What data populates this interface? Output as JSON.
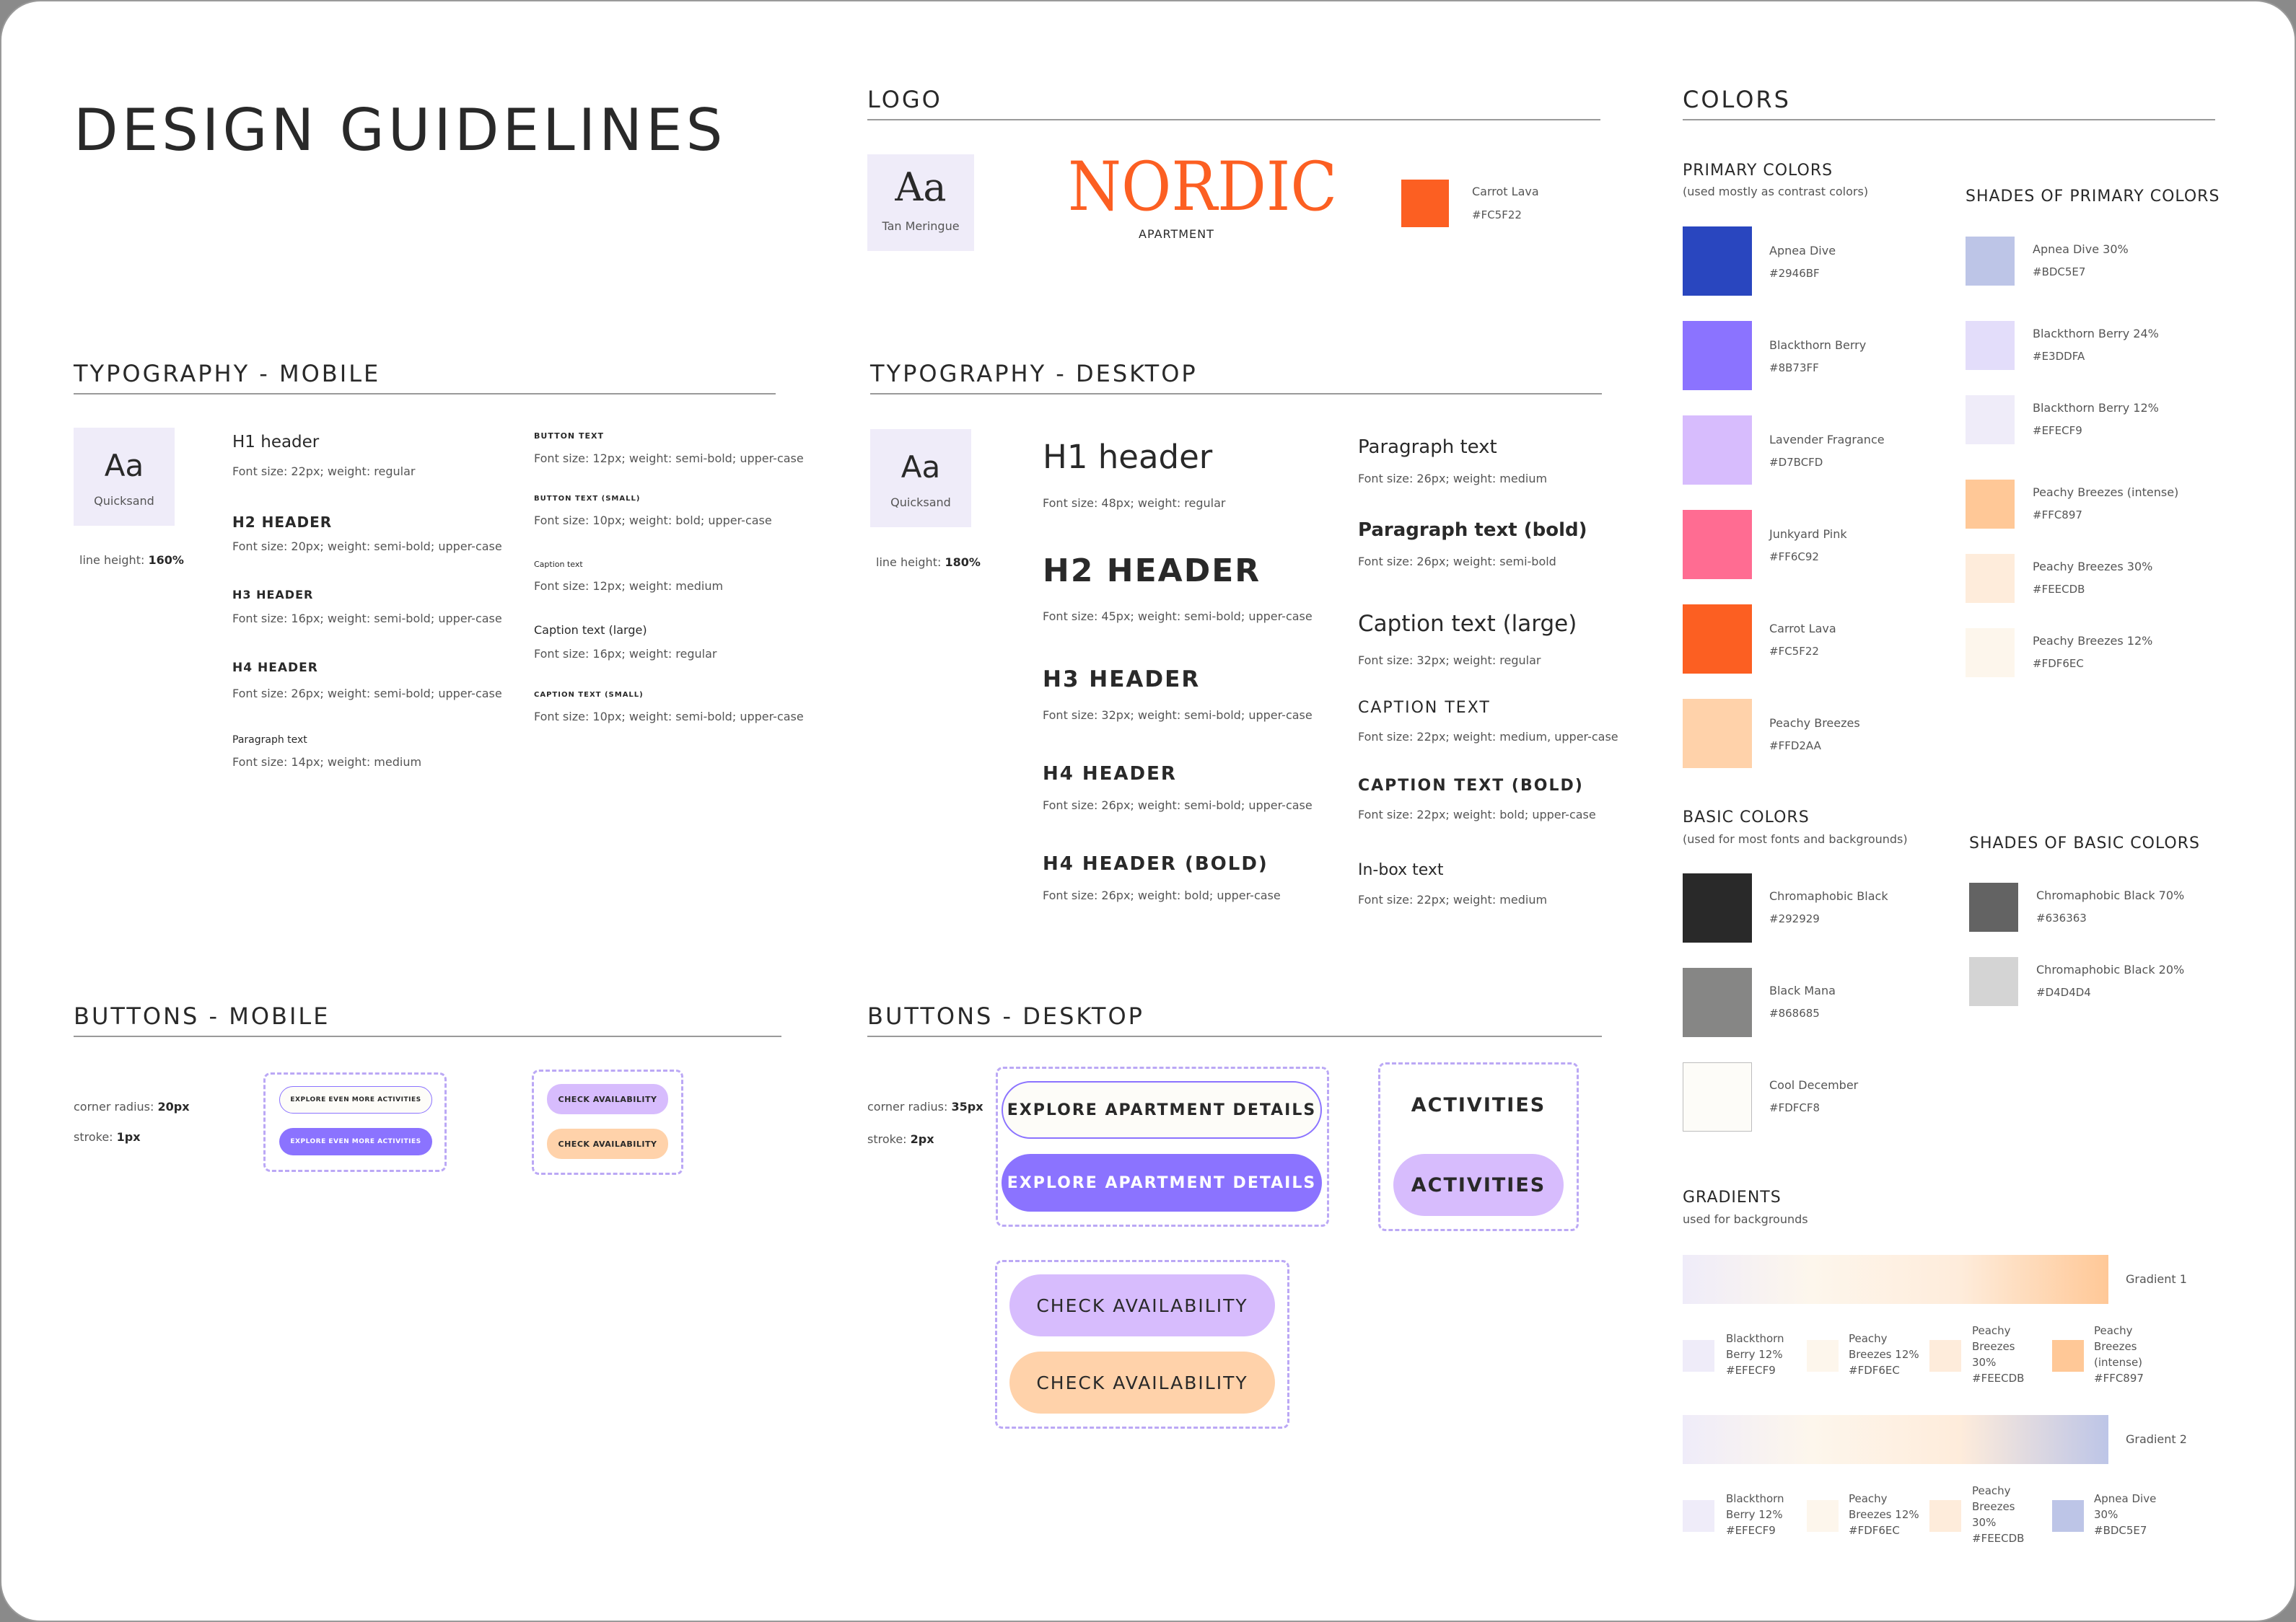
{
  "title": "DESIGN GUIDELINES",
  "logo": {
    "heading": "LOGO",
    "font_sample": "Aa",
    "font_name": "Tan Meringue",
    "brand": "NORDIC",
    "brand_sub": "APARTMENT",
    "brand_color": {
      "name": "Carrot Lava",
      "hex": "#FC5F22"
    }
  },
  "colors": {
    "heading": "COLORS",
    "primary_heading": "PRIMARY COLORS",
    "primary_note": "(used mostly as contrast colors)",
    "primary": [
      {
        "name": "Apnea Dive",
        "hex": "#2946BF"
      },
      {
        "name": "Blackthorn Berry",
        "hex": "#8B73FF"
      },
      {
        "name": "Lavender Fragrance",
        "hex": "#D7BCFD"
      },
      {
        "name": "Junkyard Pink",
        "hex": "#FF6C92"
      },
      {
        "name": "Carrot Lava",
        "hex": "#FC5F22"
      },
      {
        "name": "Peachy Breezes",
        "hex": "#FFD2AA"
      }
    ],
    "shades_primary_heading": "SHADES OF PRIMARY COLORS",
    "shades_primary": [
      {
        "name": "Apnea Dive 30%",
        "hex": "#BDC5E7"
      },
      {
        "name": "Blackthorn Berry 24%",
        "hex": "#E3DDFA"
      },
      {
        "name": "Blackthorn Berry 12%",
        "hex": "#EFECF9"
      },
      {
        "name": "Peachy Breezes (intense)",
        "hex": "#FFC897"
      },
      {
        "name": "Peachy Breezes 30%",
        "hex": "#FEECDB"
      },
      {
        "name": "Peachy Breezes 12%",
        "hex": "#FDF6EC"
      }
    ],
    "basic_heading": "BASIC COLORS",
    "basic_note": "(used for most fonts and backgrounds)",
    "basic": [
      {
        "name": "Chromaphobic Black",
        "hex": "#292929"
      },
      {
        "name": "Black Mana",
        "hex": "#868685"
      },
      {
        "name": "Cool December",
        "hex": "#FDFCF8"
      }
    ],
    "shades_basic_heading": "SHADES OF BASIC COLORS",
    "shades_basic": [
      {
        "name": "Chromaphobic Black 70%",
        "hex": "#636363"
      },
      {
        "name": "Chromaphobic Black 20%",
        "hex": "#D4D4D4"
      }
    ],
    "gradients_heading": "GRADIENTS",
    "gradients_note": "used for backgrounds",
    "gradients": [
      {
        "label": "Gradient 1",
        "stops": [
          {
            "name_lines": [
              "Blackthorn",
              "Berry 12%"
            ],
            "hex": "#EFECF9"
          },
          {
            "name_lines": [
              "Peachy",
              "Breezes 12%"
            ],
            "hex": "#FDF6EC"
          },
          {
            "name_lines": [
              "Peachy",
              "Breezes",
              "30%"
            ],
            "hex": "#FEECDB"
          },
          {
            "name_lines": [
              "Peachy",
              "Breezes",
              "(intense)"
            ],
            "hex": "#FFC897"
          }
        ]
      },
      {
        "label": "Gradient 2",
        "stops": [
          {
            "name_lines": [
              "Blackthorn",
              "Berry 12%"
            ],
            "hex": "#EFECF9"
          },
          {
            "name_lines": [
              "Peachy",
              "Breezes 12%"
            ],
            "hex": "#FDF6EC"
          },
          {
            "name_lines": [
              "Peachy",
              "Breezes",
              "30%"
            ],
            "hex": "#FEECDB"
          },
          {
            "name_lines": [
              "Apnea Dive",
              "30%"
            ],
            "hex": "#BDC5E7"
          }
        ]
      }
    ]
  },
  "typo_mobile": {
    "heading": "TYPOGRAPHY - MOBILE",
    "font_sample": "Aa",
    "font_name": "Quicksand",
    "line_height_label": "line height:",
    "line_height_value": "160%",
    "col1": [
      {
        "label": "H1 header",
        "spec": "Font size: 22px; weight: regular"
      },
      {
        "label": "H2 HEADER",
        "spec": "Font size: 20px; weight: semi-bold; upper-case"
      },
      {
        "label": "H3 HEADER",
        "spec": "Font size: 16px; weight: semi-bold; upper-case"
      },
      {
        "label": "H4 HEADER",
        "spec": "Font size: 26px; weight: semi-bold; upper-case"
      },
      {
        "label": "Paragraph text",
        "spec": "Font size: 14px; weight: medium"
      }
    ],
    "col2": [
      {
        "label": "BUTTON TEXT",
        "spec": "Font size: 12px; weight: semi-bold; upper-case"
      },
      {
        "label": "BUTTON TEXT (SMALL)",
        "spec": "Font size: 10px; weight: bold; upper-case"
      },
      {
        "label": "Caption text",
        "spec": "Font size: 12px; weight: medium"
      },
      {
        "label": "Caption text (large)",
        "spec": "Font size: 16px; weight: regular"
      },
      {
        "label": "CAPTION TEXT (SMALL)",
        "spec": "Font size: 10px; weight: semi-bold; upper-case"
      }
    ]
  },
  "typo_desktop": {
    "heading": "TYPOGRAPHY - DESKTOP",
    "font_sample": "Aa",
    "font_name": "Quicksand",
    "line_height_label": "line height:",
    "line_height_value": "180%",
    "col1": [
      {
        "label": "H1 header",
        "spec": "Font size: 48px; weight: regular"
      },
      {
        "label": "H2 HEADER",
        "spec": "Font size: 45px; weight: semi-bold; upper-case"
      },
      {
        "label": "H3 HEADER",
        "spec": "Font size: 32px; weight: semi-bold; upper-case"
      },
      {
        "label": "H4 HEADER",
        "spec": "Font size: 26px; weight: semi-bold; upper-case"
      },
      {
        "label": "H4 HEADER (BOLD)",
        "spec": "Font size: 26px; weight: bold; upper-case"
      }
    ],
    "col2": [
      {
        "label": "Paragraph text",
        "spec": "Font size: 26px; weight: medium"
      },
      {
        "label": "Paragraph text (bold)",
        "spec": "Font size: 26px; weight: semi-bold"
      },
      {
        "label": "Caption text (large)",
        "spec": "Font size: 32px; weight: regular"
      },
      {
        "label": "CAPTION TEXT",
        "spec": "Font size: 22px; weight: medium, upper-case"
      },
      {
        "label": "CAPTION TEXT (BOLD)",
        "spec": "Font size: 22px; weight: bold; upper-case"
      },
      {
        "label": "In-box text",
        "spec": "Font size: 22px; weight: medium"
      }
    ]
  },
  "buttons_mobile": {
    "heading": "BUTTONS - MOBILE",
    "radius_label": "corner radius:",
    "radius_value": "20px",
    "stroke_label": "stroke:",
    "stroke_value": "1px",
    "explore_outline": "EXPLORE EVEN MORE ACTIVITIES",
    "explore_filled": "EXPLORE EVEN MORE ACTIVITIES",
    "check_lavender": "CHECK AVAILABILITY",
    "check_peach": "CHECK AVAILABILITY"
  },
  "buttons_desktop": {
    "heading": "BUTTONS - DESKTOP",
    "radius_label": "corner radius:",
    "radius_value": "35px",
    "stroke_label": "stroke:",
    "stroke_value": "2px",
    "explore_outline": "EXPLORE APARTMENT DETAILS",
    "explore_filled": "EXPLORE APARTMENT DETAILS",
    "activities_text": "ACTIVITIES",
    "activities_button": "ACTIVITIES",
    "check_lavender": "CHECK AVAILABILITY",
    "check_peach": "CHECK AVAILABILITY"
  }
}
